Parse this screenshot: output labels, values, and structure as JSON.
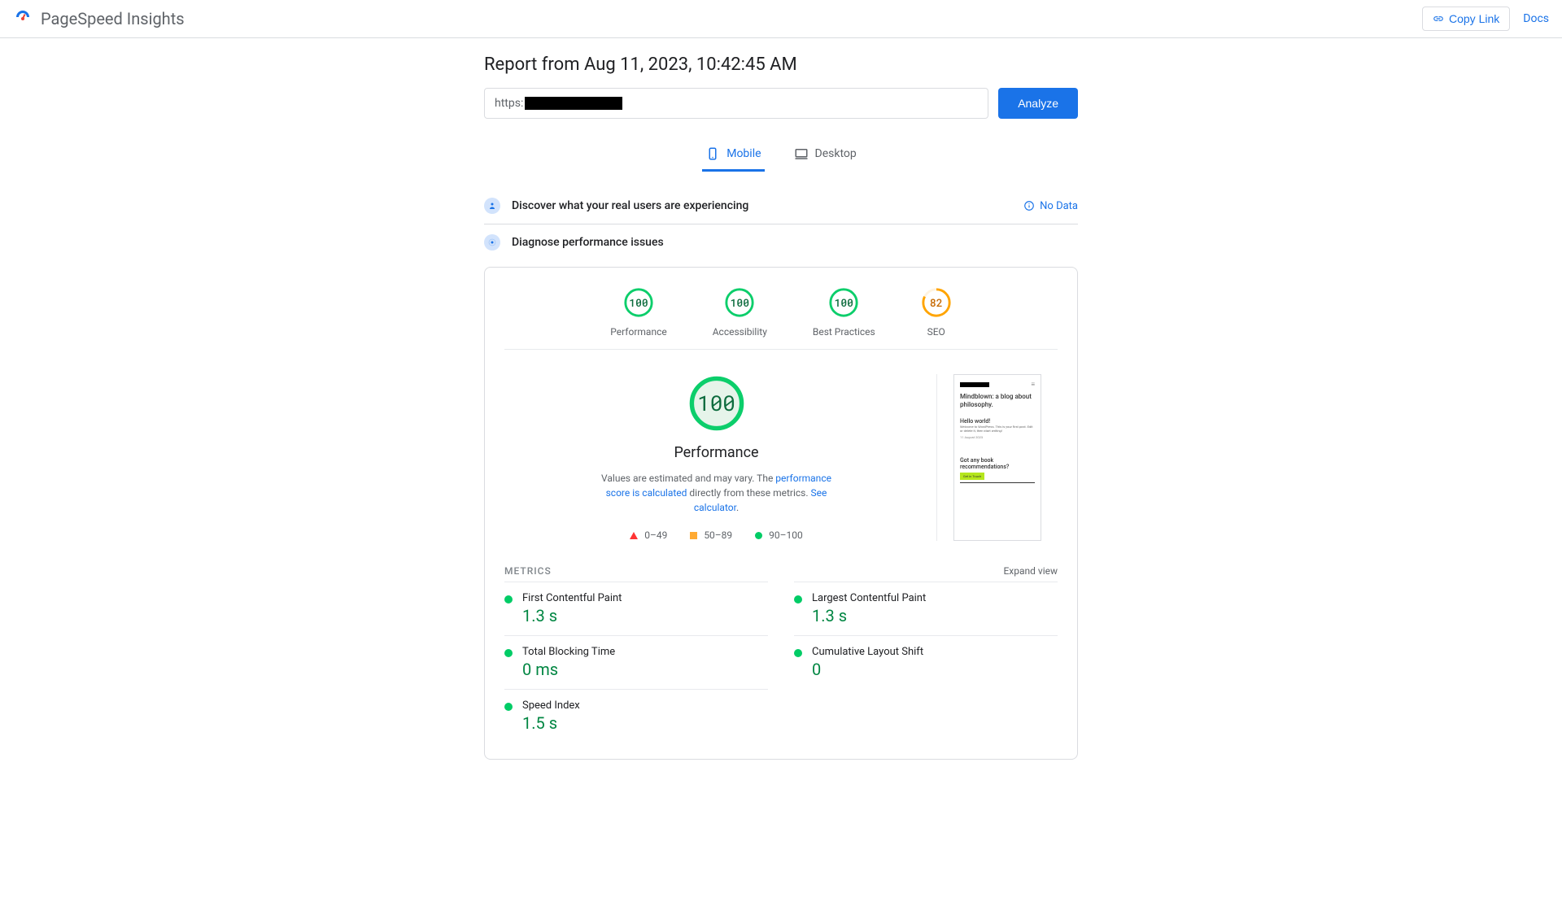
{
  "header": {
    "app_title": "PageSpeed Insights",
    "copy_link_label": "Copy Link",
    "docs_label": "Docs"
  },
  "report": {
    "title": "Report from Aug 11, 2023, 10:42:45 AM",
    "url_prefix": "https:",
    "analyze_label": "Analyze"
  },
  "tabs": {
    "mobile": "Mobile",
    "desktop": "Desktop"
  },
  "sections": {
    "discover": "Discover what your real users are experiencing",
    "no_data": "No Data",
    "diagnose": "Diagnose performance issues"
  },
  "gauges": [
    {
      "score": "100",
      "label": "Performance",
      "color": "#0cce6b"
    },
    {
      "score": "100",
      "label": "Accessibility",
      "color": "#0cce6b"
    },
    {
      "score": "100",
      "label": "Best Practices",
      "color": "#0cce6b"
    },
    {
      "score": "82",
      "label": "SEO",
      "color": "#ffa400"
    }
  ],
  "performance": {
    "score": "100",
    "title": "Performance",
    "desc_prefix": "Values are estimated and may vary. The ",
    "desc_link1": "performance score is calculated",
    "desc_middle": " directly from these metrics. ",
    "desc_link2": "See calculator",
    "desc_suffix": "."
  },
  "legend": {
    "red": "0–49",
    "orange": "50–89",
    "green": "90–100"
  },
  "preview": {
    "heading": "Mindblown: a blog about philosophy.",
    "subtitle": "Hello world!",
    "body": "Welcome to WordPress. This is your first post. Edit or delete it, then start writing!",
    "date": "11 August 2023",
    "question": "Got any book recommendations?",
    "button": "Get in Touch"
  },
  "metrics": {
    "title": "METRICS",
    "expand": "Expand view",
    "items": [
      {
        "name": "First Contentful Paint",
        "value": "1.3 s"
      },
      {
        "name": "Largest Contentful Paint",
        "value": "1.3 s"
      },
      {
        "name": "Total Blocking Time",
        "value": "0 ms"
      },
      {
        "name": "Cumulative Layout Shift",
        "value": "0"
      },
      {
        "name": "Speed Index",
        "value": "1.5 s"
      }
    ]
  }
}
